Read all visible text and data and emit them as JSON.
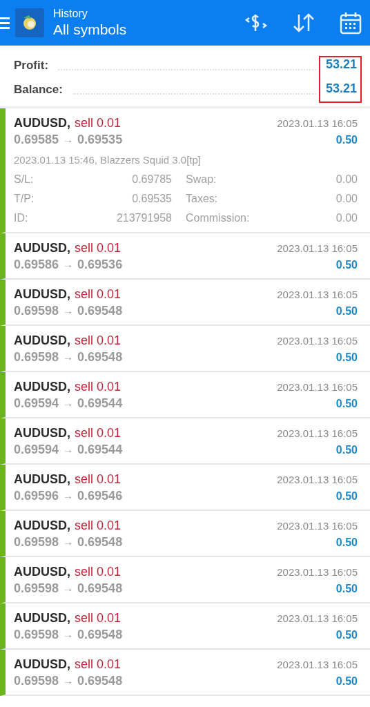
{
  "header": {
    "subtitle": "History",
    "title": "All symbols"
  },
  "summary": {
    "highlighted": true,
    "items": [
      {
        "label": "Profit:",
        "value": "53.21"
      },
      {
        "label": "Balance:",
        "value": "53.21"
      }
    ]
  },
  "deals": [
    {
      "symbol": "AUDUSD,",
      "type": "sell 0.01",
      "open": "0.69585",
      "arrow": "→",
      "close": "0.69535",
      "time": "2023.01.13 16:05",
      "profit": "0.50",
      "expanded": true,
      "detail": "2023.01.13 15:46, Blazzers Squid 3.0[tp]",
      "fields": [
        {
          "label": "S/L:",
          "value": "0.69785"
        },
        {
          "label": "Swap:",
          "value": "0.00"
        },
        {
          "label": "T/P:",
          "value": "0.69535"
        },
        {
          "label": "Taxes:",
          "value": "0.00"
        },
        {
          "label": "ID:",
          "value": "213791958"
        },
        {
          "label": "Commission:",
          "value": "0.00"
        }
      ]
    },
    {
      "symbol": "AUDUSD,",
      "type": "sell 0.01",
      "open": "0.69586",
      "arrow": "→",
      "close": "0.69536",
      "time": "2023.01.13 16:05",
      "profit": "0.50",
      "expanded": false
    },
    {
      "symbol": "AUDUSD,",
      "type": "sell 0.01",
      "open": "0.69598",
      "arrow": "→",
      "close": "0.69548",
      "time": "2023.01.13 16:05",
      "profit": "0.50",
      "expanded": false
    },
    {
      "symbol": "AUDUSD,",
      "type": "sell 0.01",
      "open": "0.69598",
      "arrow": "→",
      "close": "0.69548",
      "time": "2023.01.13 16:05",
      "profit": "0.50",
      "expanded": false
    },
    {
      "symbol": "AUDUSD,",
      "type": "sell 0.01",
      "open": "0.69594",
      "arrow": "→",
      "close": "0.69544",
      "time": "2023.01.13 16:05",
      "profit": "0.50",
      "expanded": false
    },
    {
      "symbol": "AUDUSD,",
      "type": "sell 0.01",
      "open": "0.69594",
      "arrow": "→",
      "close": "0.69544",
      "time": "2023.01.13 16:05",
      "profit": "0.50",
      "expanded": false
    },
    {
      "symbol": "AUDUSD,",
      "type": "sell 0.01",
      "open": "0.69596",
      "arrow": "→",
      "close": "0.69546",
      "time": "2023.01.13 16:05",
      "profit": "0.50",
      "expanded": false
    },
    {
      "symbol": "AUDUSD,",
      "type": "sell 0.01",
      "open": "0.69598",
      "arrow": "→",
      "close": "0.69548",
      "time": "2023.01.13 16:05",
      "profit": "0.50",
      "expanded": false
    },
    {
      "symbol": "AUDUSD,",
      "type": "sell 0.01",
      "open": "0.69598",
      "arrow": "→",
      "close": "0.69548",
      "time": "2023.01.13 16:05",
      "profit": "0.50",
      "expanded": false
    },
    {
      "symbol": "AUDUSD,",
      "type": "sell 0.01",
      "open": "0.69598",
      "arrow": "→",
      "close": "0.69548",
      "time": "2023.01.13 16:05",
      "profit": "0.50",
      "expanded": false
    },
    {
      "symbol": "AUDUSD,",
      "type": "sell 0.01",
      "open": "0.69598",
      "arrow": "→",
      "close": "0.69548",
      "time": "2023.01.13 16:05",
      "profit": "0.50",
      "expanded": false
    }
  ]
}
